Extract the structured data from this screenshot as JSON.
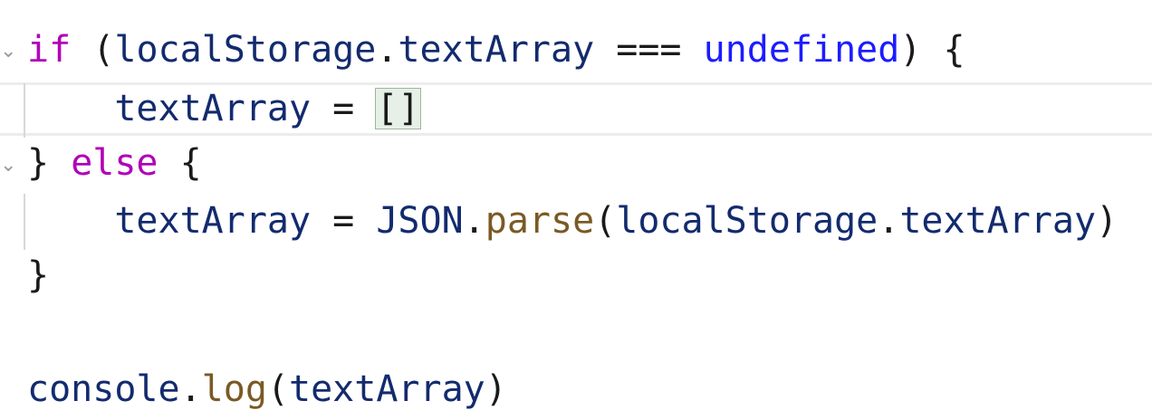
{
  "code": {
    "line1": {
      "kw_if": "if",
      "open_paren": "(",
      "var_local": "localStorage",
      "dot": ".",
      "prop_text": "textArray",
      "op": " === ",
      "const_undefined": "undefined",
      "close_paren": ")",
      "brace": " {"
    },
    "line2": {
      "var_text": "textArray",
      "op": " = ",
      "brackets": "[]"
    },
    "line3": {
      "brace_close": "}",
      "kw_else": "else",
      "brace_open": " {"
    },
    "line4": {
      "var_text": "textArray",
      "op": " = ",
      "obj_json": "JSON",
      "dot": ".",
      "fn_parse": "parse",
      "open_paren": "(",
      "var_local": "localStorage",
      "dot2": ".",
      "prop_text": "textArray",
      "close_paren": ")"
    },
    "line5": {
      "brace_close": "}"
    },
    "line7": {
      "obj_console": "console",
      "dot": ".",
      "fn_log": "log",
      "open_paren": "(",
      "var_text": "textArray",
      "close_paren": ")"
    }
  },
  "fold_glyph": "⌄",
  "colors": {
    "keyword": "#b000b8",
    "constant": "#1c1cff",
    "variable": "#132b6e",
    "function": "#7a5a24",
    "punctuation": "#1a1a1a",
    "bracket_match_bg": "#e6f0e6"
  }
}
